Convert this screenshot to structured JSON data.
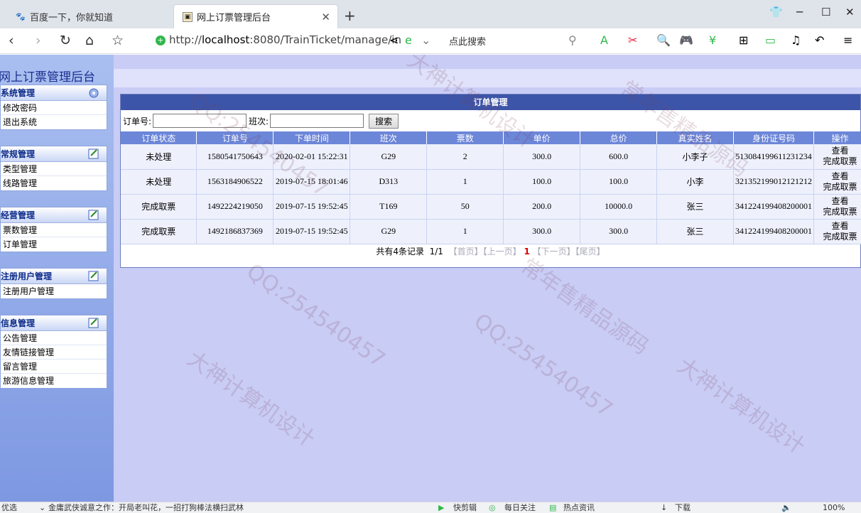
{
  "browser": {
    "tabs": [
      {
        "title": "百度一下，你就知道",
        "active": false
      },
      {
        "title": "网上订票管理后台",
        "active": true
      }
    ],
    "url_prefix": "http://",
    "url_host": "localhost",
    "url_rest": ":8080/TrainTicket/manage/in",
    "search_placeholder": "点此搜索"
  },
  "app": {
    "title": "网上订票管理后台"
  },
  "sidebar": {
    "groups": [
      {
        "title": "系统管理",
        "items": [
          "修改密码",
          "退出系统"
        ]
      },
      {
        "title": "常规管理",
        "items": [
          "类型管理",
          "线路管理"
        ]
      },
      {
        "title": "经营管理",
        "items": [
          "票数管理",
          "订单管理"
        ]
      },
      {
        "title": "注册用户管理",
        "items": [
          "注册用户管理"
        ]
      },
      {
        "title": "信息管理",
        "items": [
          "公告管理",
          "友情链接管理",
          "留言管理",
          "旅游信息管理"
        ]
      }
    ]
  },
  "panel": {
    "title": "订单管理",
    "order_no_label": "订单号:",
    "train_label": "班次:",
    "search_button": "搜索"
  },
  "table": {
    "headers": [
      "订单状态",
      "订单号",
      "下单时间",
      "班次",
      "票数",
      "单价",
      "总价",
      "真实姓名",
      "身份证号码",
      "操作"
    ],
    "rows": [
      [
        "未处理",
        "1580541750643",
        "2020-02-01 15:22:31",
        "G29",
        "2",
        "300.0",
        "600.0",
        "小李子",
        "513084199611231234"
      ],
      [
        "未处理",
        "1563184906522",
        "2019-07-15 18:01:46",
        "D313",
        "1",
        "100.0",
        "100.0",
        "小李",
        "321352199012121212"
      ],
      [
        "完成取票",
        "1492224219050",
        "2019-07-15 19:52:45",
        "T169",
        "50",
        "200.0",
        "10000.0",
        "张三",
        "341224199408200001"
      ],
      [
        "完成取票",
        "1492186837369",
        "2019-07-15 19:52:45",
        "G29",
        "1",
        "300.0",
        "300.0",
        "张三",
        "341224199408200001"
      ]
    ],
    "op_view": "查看",
    "op_finish": "完成取票"
  },
  "pager": {
    "total": "共有4条记录",
    "page": "1/1",
    "first": "【首页】",
    "prev": "【上一页】",
    "current": "1",
    "next": "【下一页】",
    "last": "【尾页】"
  },
  "statusbar": {
    "left": "优选",
    "news": "金庸武侠诚意之作：开局老叫花，一招打狗棒法横扫武林",
    "items": [
      "快剪辑",
      "每日关注",
      "热点资讯",
      "下载"
    ],
    "zoom": "100%"
  },
  "watermarks": [
    "QQ:254540457",
    "大神计算机设计",
    "常年售精品源码"
  ]
}
